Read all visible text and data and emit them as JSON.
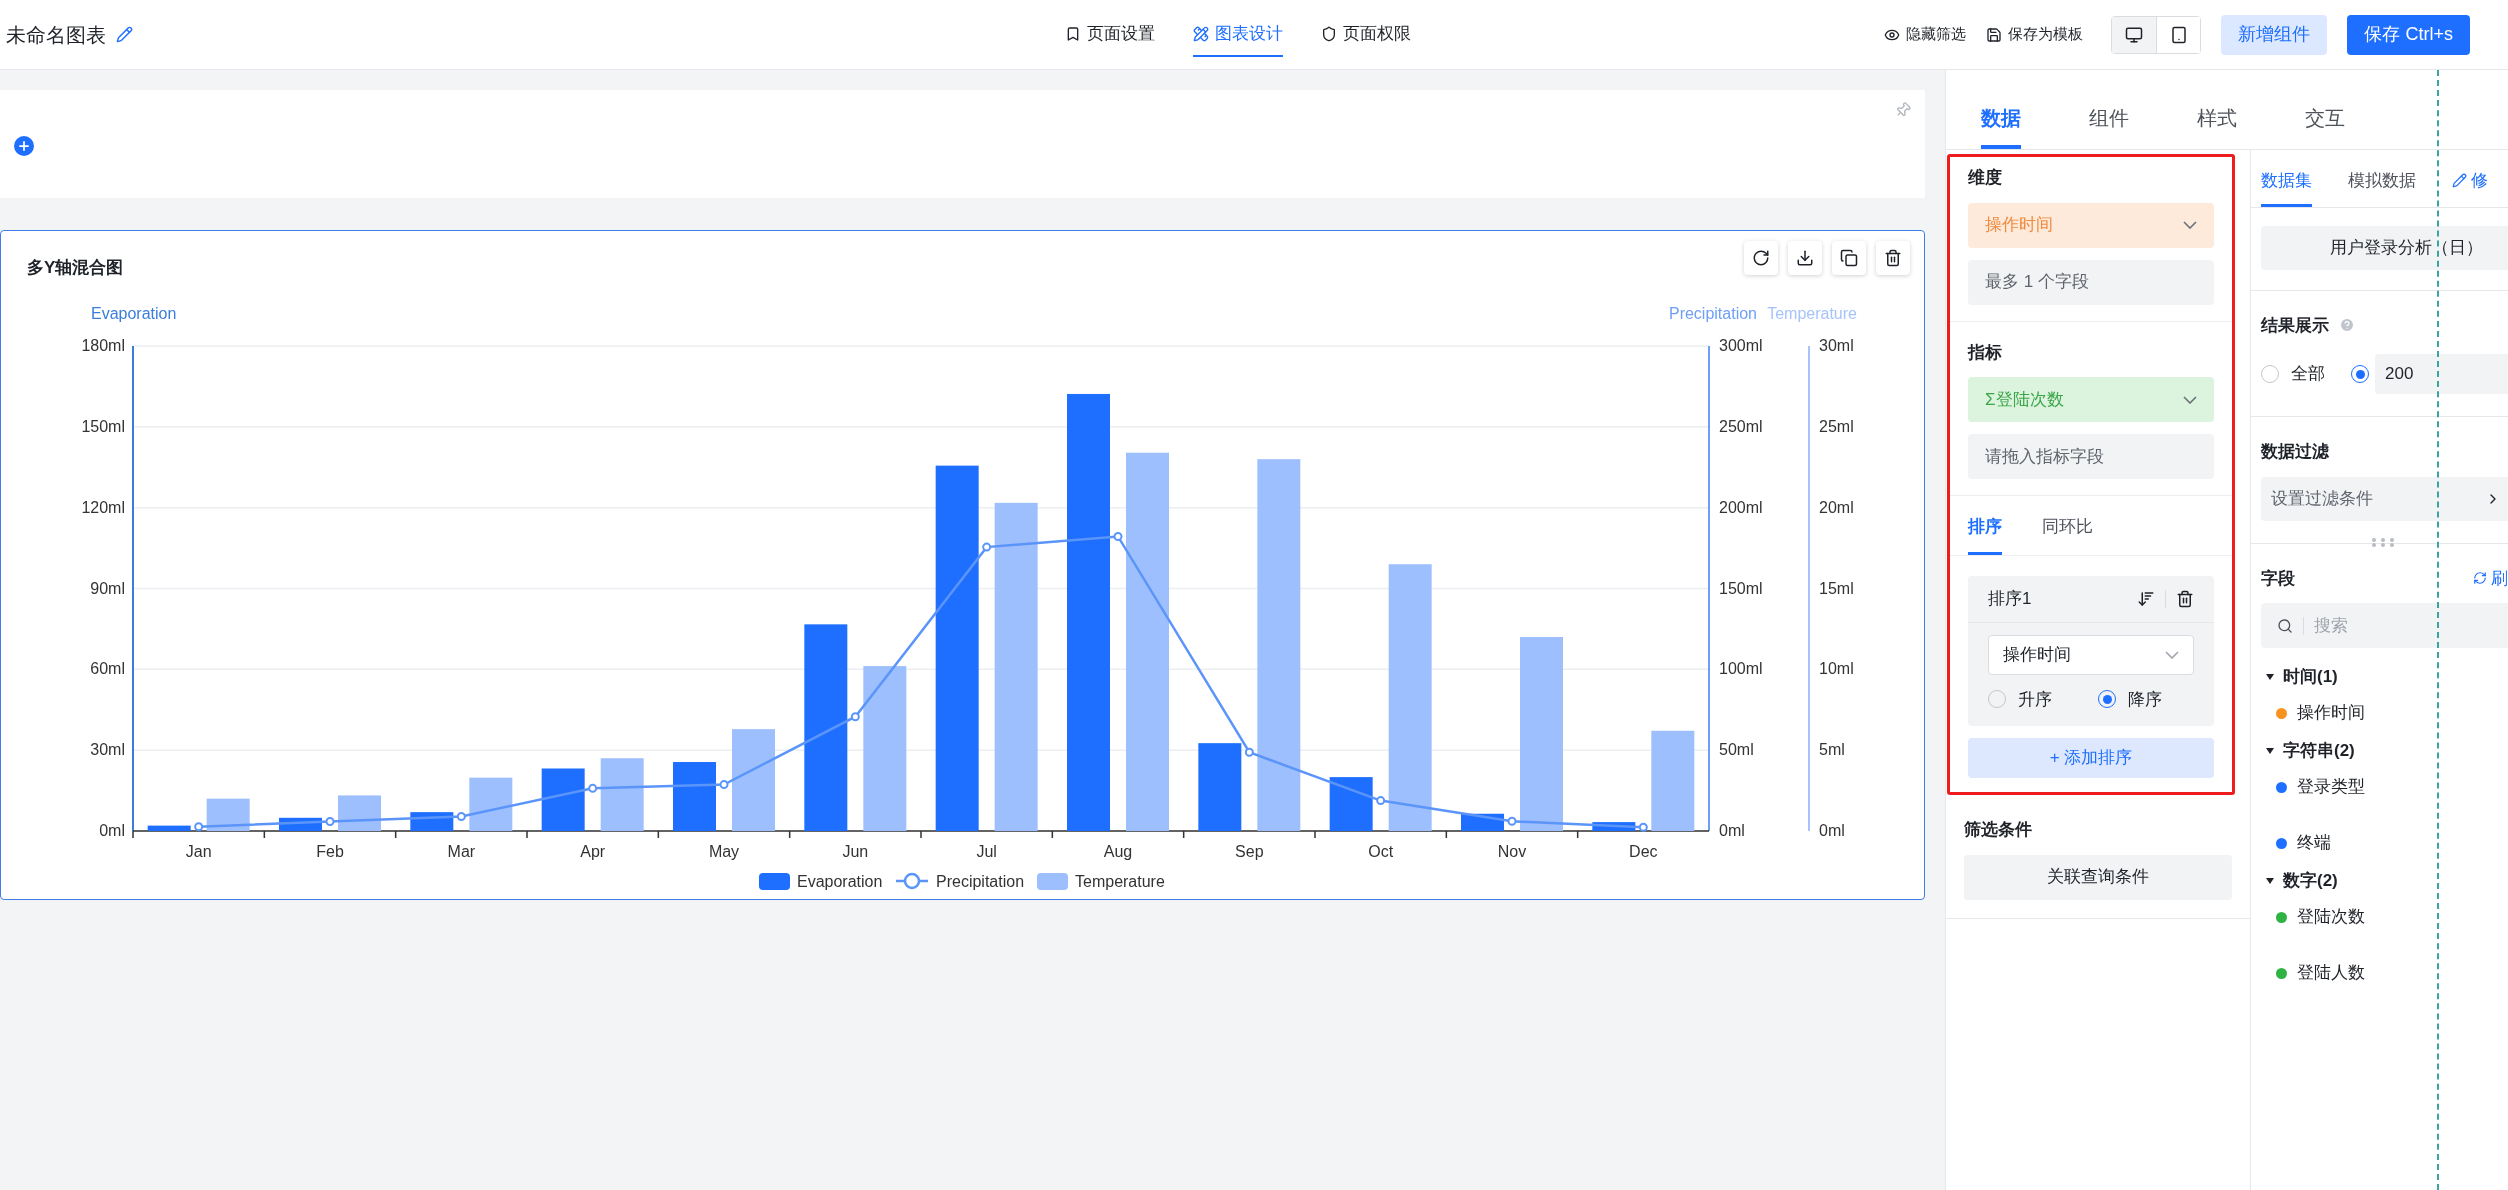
{
  "header": {
    "title": "未命名图表",
    "tabs": [
      {
        "label": "页面设置",
        "selected": false
      },
      {
        "label": "图表设计",
        "selected": true
      },
      {
        "label": "页面权限",
        "selected": false
      }
    ],
    "links": [
      "隐藏筛选",
      "保存为模板"
    ],
    "devices": [
      {
        "selected": true
      },
      {
        "selected": false
      }
    ],
    "buttons": [
      {
        "label": "新增组件",
        "kind": "secondary"
      },
      {
        "label": "保存 Ctrl+s",
        "kind": "primary"
      }
    ]
  },
  "chart": {
    "title": "多Y轴混合图",
    "chart_data": {
      "type": "bar",
      "grid": true,
      "legend": "bottom",
      "categories": [
        "Jan",
        "Feb",
        "Mar",
        "Apr",
        "May",
        "Jun",
        "Jul",
        "Aug",
        "Sep",
        "Oct",
        "Nov",
        "Dec"
      ],
      "ylabel": "Evaporation",
      "ylim": [
        0,
        180
      ],
      "yticks": [
        {
          "value": 0,
          "label": "0ml"
        },
        {
          "value": 30,
          "label": "30ml"
        },
        {
          "value": 60,
          "label": "60ml"
        },
        {
          "value": 90,
          "label": "90ml"
        },
        {
          "value": 120,
          "label": "120ml"
        },
        {
          "value": 150,
          "label": "150ml"
        },
        {
          "value": 180,
          "label": "180ml"
        }
      ],
      "y2label": "Precipitation",
      "y2lim": [
        0,
        300
      ],
      "y2ticks": [
        {
          "value": 0,
          "label": "0ml"
        },
        {
          "value": 50,
          "label": "50ml"
        },
        {
          "value": 100,
          "label": "100ml"
        },
        {
          "value": 150,
          "label": "150ml"
        },
        {
          "value": 200,
          "label": "200ml"
        },
        {
          "value": 250,
          "label": "250ml"
        },
        {
          "value": 300,
          "label": "300ml"
        }
      ],
      "y3label": "Temperature",
      "y3lim": [
        0,
        30
      ],
      "y3ticks": [
        {
          "value": 0,
          "label": "0ml"
        },
        {
          "value": 5,
          "label": "5ml"
        },
        {
          "value": 10,
          "label": "10ml"
        },
        {
          "value": 15,
          "label": "15ml"
        },
        {
          "value": 20,
          "label": "20ml"
        },
        {
          "value": 25,
          "label": "25ml"
        },
        {
          "value": 30,
          "label": "30ml"
        }
      ],
      "series": [
        {
          "name": "Evaporation",
          "color": "#1e6fff",
          "values": [
            2.0,
            4.9,
            7.0,
            23.2,
            25.6,
            76.7,
            135.6,
            162.2,
            32.6,
            20.0,
            6.4,
            3.3
          ]
        },
        {
          "name": "Precipitation",
          "type": "line",
          "marker": "circle",
          "axis": "y2",
          "color": "#5b95f9",
          "values": [
            2.6,
            5.9,
            9.0,
            26.4,
            28.7,
            70.7,
            175.6,
            182.2,
            48.7,
            18.8,
            6.0,
            2.3
          ]
        },
        {
          "name": "Temperature",
          "axis": "y3",
          "color": "#9dbffd",
          "values": [
            2.0,
            2.2,
            3.3,
            4.5,
            6.3,
            10.2,
            20.3,
            23.4,
            23.0,
            16.5,
            12.0,
            6.2
          ]
        }
      ]
    }
  },
  "config": {
    "tabs": [
      {
        "label": "数据",
        "selected": true
      },
      {
        "label": "组件",
        "selected": false
      },
      {
        "label": "样式",
        "selected": false
      },
      {
        "label": "交互",
        "selected": false
      }
    ],
    "dimension": {
      "label": "维度",
      "field": "操作时间",
      "hint": "最多 1 个字段"
    },
    "metric": {
      "label": "指标",
      "field": "Σ登陆次数",
      "hint": "请拖入指标字段"
    },
    "sub_tabs": [
      {
        "label": "排序",
        "selected": true
      },
      {
        "label": "同环比",
        "selected": false
      }
    ],
    "sort": {
      "title": "排序1",
      "field": "操作时间",
      "options": [
        {
          "label": "升序",
          "selected": false
        },
        {
          "label": "降序",
          "selected": true
        }
      ],
      "add_button": "+ 添加排序"
    },
    "filter": {
      "label": "筛选条件",
      "button": "关联查询条件"
    }
  },
  "dataset": {
    "tabs": [
      {
        "label": "数据集",
        "selected": true
      },
      {
        "label": "模拟数据",
        "selected": false
      }
    ],
    "edit_link": "修",
    "name": "用户登录分析（日）",
    "result": {
      "label": "结果展示",
      "options": [
        {
          "label": "全部",
          "selected": false
        },
        {
          "selected": true
        }
      ],
      "limit": "200"
    },
    "data_filter": {
      "label": "数据过滤",
      "button": "设置过滤条件"
    },
    "fields": {
      "label": "字段",
      "refresh_link": "刷",
      "search_placeholder": "搜索",
      "groups": [
        {
          "label": "时间(1)",
          "expanded": true,
          "children": [
            {
              "label": "操作时间",
              "color": "#f7931e"
            }
          ]
        },
        {
          "label": "字符串(2)",
          "expanded": true,
          "children": [
            {
              "label": "登录类型",
              "color": "#1e6fff"
            },
            {
              "label": "终端",
              "color": "#1e6fff"
            }
          ]
        },
        {
          "label": "数字(2)",
          "expanded": true,
          "children": [
            {
              "label": "登陆次数",
              "color": "#2fb344"
            },
            {
              "label": "登陆人数",
              "color": "#2fb344"
            }
          ]
        }
      ]
    }
  }
}
